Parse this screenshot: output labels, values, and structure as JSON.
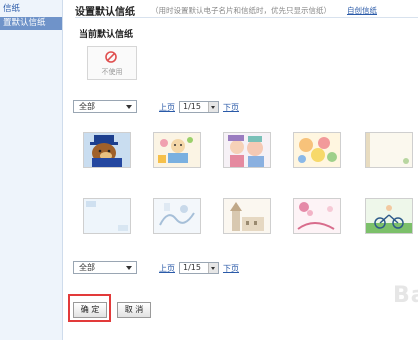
{
  "sidebar": {
    "items": [
      {
        "label": "信纸"
      },
      {
        "label": "置默认信纸"
      }
    ]
  },
  "header": {
    "title": "设置默认信纸",
    "hint": "（用时设置默认电子名片和信纸时，优先只显示信纸）",
    "custom_link": "自创信纸"
  },
  "current": {
    "label": "当前默认信纸",
    "no_use_text": "不使用"
  },
  "filter_top": {
    "category": "全部",
    "prev": "上页",
    "page": "1/15",
    "next": "下页"
  },
  "filter_bottom": {
    "category": "全部",
    "prev": "上页",
    "page": "1/15",
    "next": "下页"
  },
  "thumbnails": [
    {
      "icon": "bear-with-hat"
    },
    {
      "icon": "cartoon-party"
    },
    {
      "icon": "cartoon-kids"
    },
    {
      "icon": "cartoon-characters"
    },
    {
      "icon": "plain-beige-letter"
    },
    {
      "icon": "light-blue-letter"
    },
    {
      "icon": "winter-sketch"
    },
    {
      "icon": "castle-tower"
    },
    {
      "icon": "pink-floral"
    },
    {
      "icon": "cyclist-green"
    }
  ],
  "actions": {
    "ok": "确 定",
    "cancel": "取 消"
  },
  "watermark": "Ba"
}
